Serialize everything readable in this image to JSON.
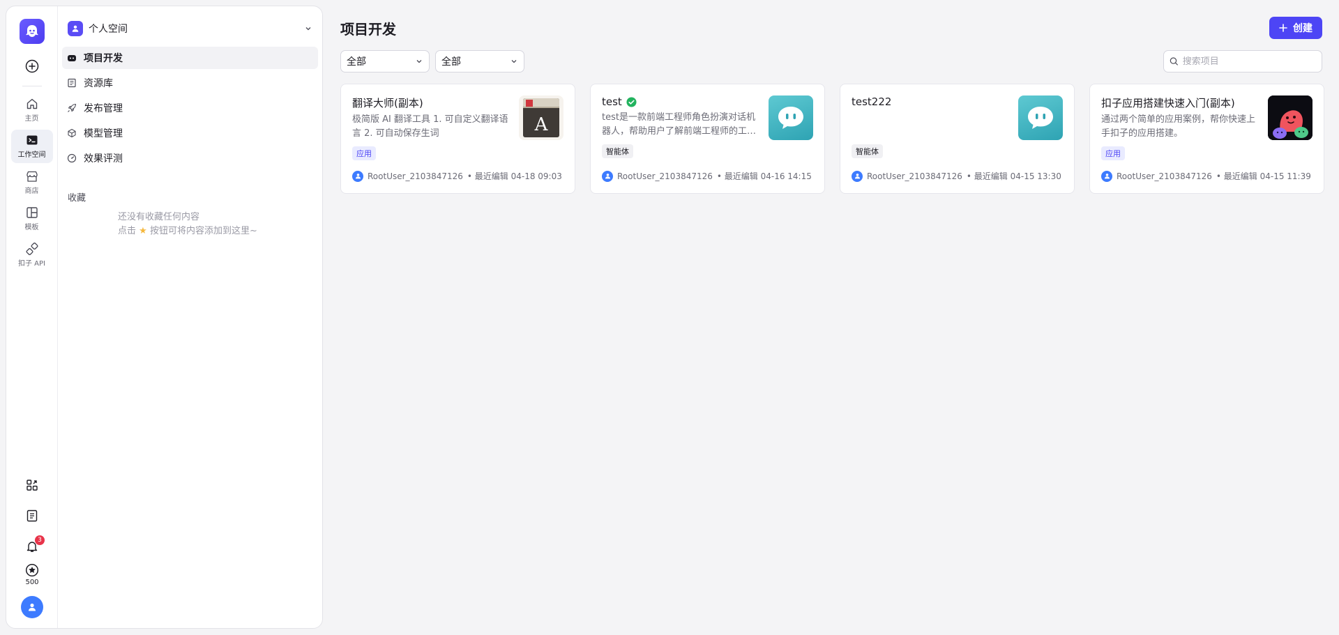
{
  "rail": {
    "items": [
      {
        "label": "主页",
        "icon": "home-icon"
      },
      {
        "label": "工作空间",
        "icon": "terminal-icon",
        "active": true
      },
      {
        "label": "商店",
        "icon": "store-icon"
      },
      {
        "label": "模板",
        "icon": "template-icon"
      },
      {
        "label": "扣子 API",
        "icon": "api-link-icon"
      }
    ],
    "notification_count": "3",
    "credits": "500"
  },
  "nav": {
    "space_name": "个人空间",
    "items": [
      {
        "label": "项目开发",
        "icon": "robot-icon",
        "active": true
      },
      {
        "label": "资源库",
        "icon": "library-icon"
      },
      {
        "label": "发布管理",
        "icon": "rocket-icon"
      },
      {
        "label": "模型管理",
        "icon": "cube-icon"
      },
      {
        "label": "效果评测",
        "icon": "gauge-icon"
      }
    ],
    "favorites_title": "收藏",
    "favorites_empty_line1": "还没有收藏任何内容",
    "favorites_empty_line2_pre": "点击",
    "favorites_empty_line2_post": "按钮可将内容添加到这里~"
  },
  "main": {
    "title": "项目开发",
    "create_label": "创建",
    "filter1": "全部",
    "filter2": "全部",
    "search_placeholder": "搜索项目"
  },
  "cards": [
    {
      "title": "翻译大师(副本)",
      "desc": "极简版 AI 翻译工具 1. 可自定义翻译语言 2. 可自动保存生词",
      "tag": "应用",
      "tag_type": "app",
      "author": "RootUser_2103847126",
      "edited": "• 最近编辑 04-18 09:03",
      "thumb": "dictionary-book"
    },
    {
      "title": "test",
      "verified": true,
      "desc": "test是一款前端工程师角色扮演对话机器人，帮助用户了解前端工程师的工作内容",
      "tag": "智能体",
      "tag_type": "agent",
      "author": "RootUser_2103847126",
      "edited": "• 最近编辑 04-16 14:15",
      "thumb": "chat-bubble"
    },
    {
      "title": "test222",
      "desc": "",
      "tag": "智能体",
      "tag_type": "agent",
      "author": "RootUser_2103847126",
      "edited": "• 最近编辑 04-15 13:30",
      "thumb": "chat-bubble"
    },
    {
      "title": "扣子应用搭建快速入门(副本)",
      "desc": "通过两个简单的应用案例，帮你快速上手扣子的应用搭建。",
      "tag": "应用",
      "tag_type": "app",
      "author": "RootUser_2103847126",
      "edited": "• 最近编辑 04-15 11:39",
      "thumb": "mascots"
    }
  ],
  "colors": {
    "accent": "#4d45f5",
    "avatar_blue": "#3d7bff",
    "badge_red": "#e8344a",
    "verified_green": "#22b35e"
  }
}
